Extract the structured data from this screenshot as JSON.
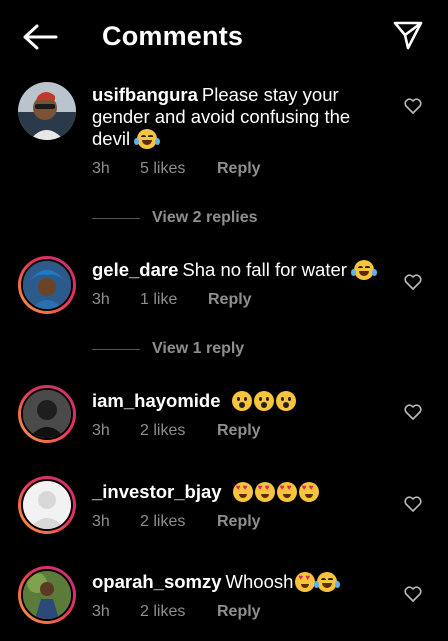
{
  "header": {
    "title": "Comments",
    "back_icon": "arrow-left-icon",
    "send_icon": "paper-plane-icon"
  },
  "comments": [
    {
      "username": "usifbangura",
      "text": "Please stay your gender and avoid confusing the devil",
      "emoji": [
        "laugh"
      ],
      "time": "3h",
      "likes": "5 likes",
      "reply": "Reply",
      "view_replies": "View 2 replies"
    },
    {
      "username": "gele_dare",
      "text": "Sha no fall for water",
      "emoji": [
        "laugh"
      ],
      "time": "3h",
      "likes": "1 like",
      "reply": "Reply",
      "view_replies": "View 1 reply"
    },
    {
      "username": "iam_hayomide",
      "text": "",
      "emoji": [
        "wow",
        "wow",
        "wow"
      ],
      "time": "3h",
      "likes": "2 likes",
      "reply": "Reply"
    },
    {
      "username": "_investor_bjay",
      "text": "",
      "emoji": [
        "love",
        "love",
        "love",
        "love"
      ],
      "time": "3h",
      "likes": "2 likes",
      "reply": "Reply"
    },
    {
      "username": "oparah_somzy",
      "text": "Whoosh",
      "emoji": [
        "love",
        "laugh"
      ],
      "time": "3h",
      "likes": "2 likes",
      "reply": "Reply"
    }
  ],
  "colors": {
    "background": "#000000",
    "text": "#ffffff",
    "secondary": "#8e8e8e",
    "ring_start": "#f9a33b",
    "ring_end": "#c1307c"
  }
}
